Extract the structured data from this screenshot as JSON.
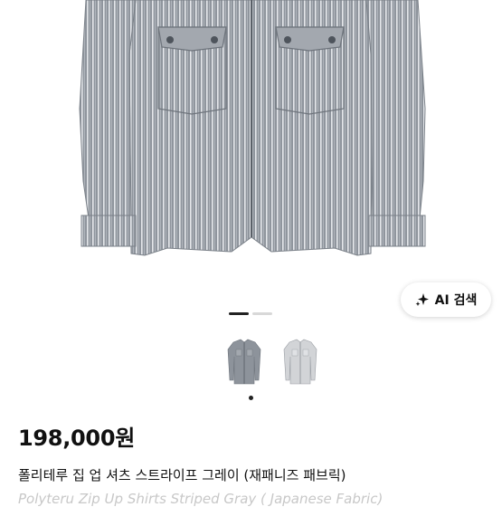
{
  "product": {
    "price": "198,000원",
    "title": "폴리테루 집 업 셔츠 스트라이프 그레이 (재패니즈 패브릭)",
    "subtitle": "Polyteru Zip Up Shirts Striped Gray ( Japanese Fabric)"
  },
  "ai_search": {
    "label": "AI 검색",
    "icon": "sparkle-icon"
  },
  "carousel": {
    "total": 2,
    "current": 1
  },
  "colors": {
    "shirt_main": "#9aa0a8",
    "stripe": "#e8eaee",
    "thumb_light": "#cfd1d4",
    "text": "#111111",
    "muted": "#c8c8c8"
  }
}
